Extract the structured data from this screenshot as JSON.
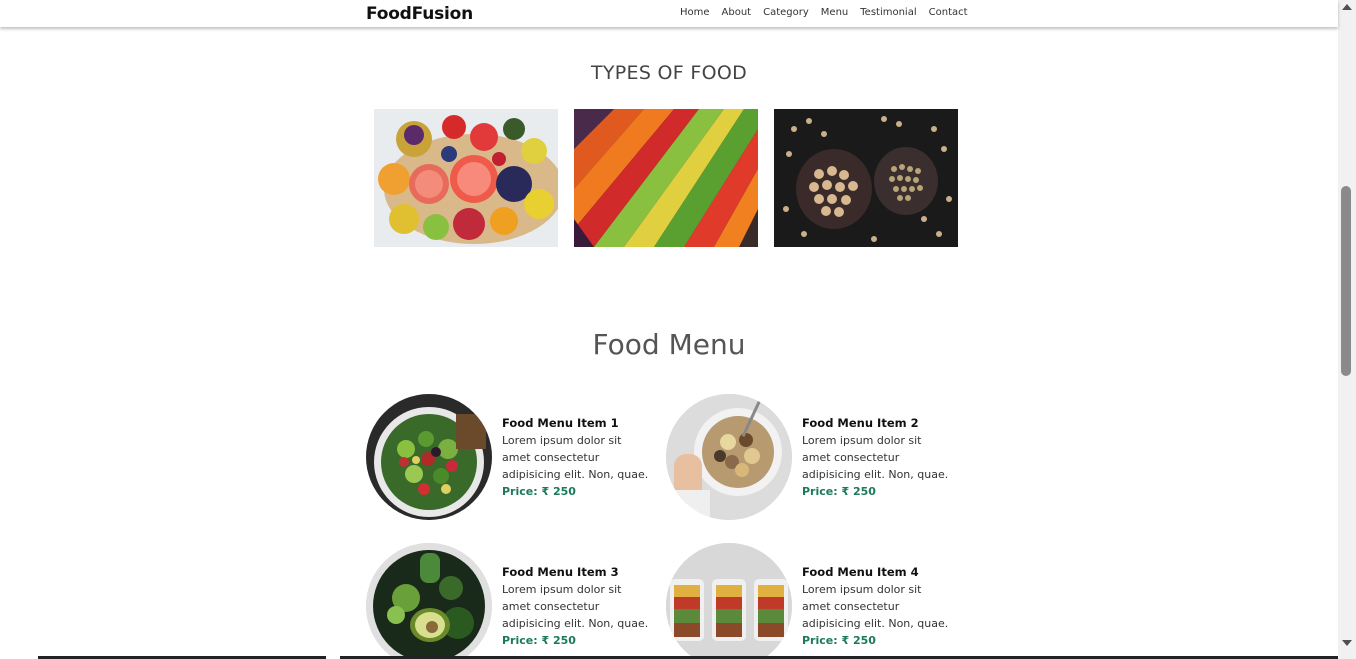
{
  "navbar": {
    "brand": "FoodFusion",
    "links": [
      "Home",
      "About",
      "Category",
      "Menu",
      "Testimonial",
      "Contact"
    ]
  },
  "types_section": {
    "title": "TYPES OF FOOD",
    "images": [
      "fruits-image",
      "vegetables-image",
      "grains-image"
    ]
  },
  "menu_section": {
    "title": "Food Menu",
    "items": [
      {
        "name": "Food Menu Item 1",
        "desc_lines": [
          "Lorem ipsum dolor sit",
          "amet consectetur",
          "adipisicing elit. Non, quae."
        ],
        "price": "Price: ₹ 250"
      },
      {
        "name": "Food Menu Item 2",
        "desc_lines": [
          "Lorem ipsum dolor sit",
          "amet consectetur",
          "adipisicing elit. Non, quae."
        ],
        "price": "Price: ₹ 250"
      },
      {
        "name": "Food Menu Item 3",
        "desc_lines": [
          "Lorem ipsum dolor sit",
          "amet consectetur",
          "adipisicing elit. Non, quae."
        ],
        "price": "Price: ₹ 250"
      },
      {
        "name": "Food Menu Item 4",
        "desc_lines": [
          "Lorem ipsum dolor sit",
          "amet consectetur",
          "adipisicing elit. Non, quae."
        ],
        "price": "Price: ₹ 250"
      }
    ]
  },
  "colors": {
    "price": "#1a7a5a",
    "heading": "#444444"
  }
}
